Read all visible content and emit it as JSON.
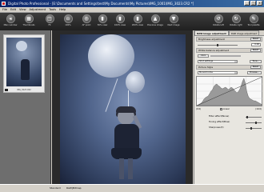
{
  "window": {
    "title": "Digital Photo Professional - [E:\\Documents and Settings\\test\\My Documents\\My Pictures\\IMG_1001\\IMG_3023.CR2 *]",
    "controls": [
      "_",
      "□",
      "x"
    ]
  },
  "menu": [
    "File",
    "Edit",
    "View",
    "Adjustment",
    "Tools",
    "Help"
  ],
  "toolbar": {
    "left": [
      {
        "label": "Main window",
        "icon": "main-window-icon"
      },
      {
        "label": "Thumbnails",
        "icon": "thumbnails-icon"
      },
      {
        "label": "Fit",
        "icon": "fit-icon"
      },
      {
        "label": "100%",
        "icon": "zoom-100-icon"
      },
      {
        "label": "AF point",
        "icon": "af-point-icon"
      },
      {
        "label": "50% view",
        "icon": "view-50-icon"
      },
      {
        "label": "100% view",
        "icon": "view-100-icon"
      },
      {
        "label": "200% view",
        "icon": "view-200-icon"
      },
      {
        "label": "Previous image",
        "icon": "previous-image-icon"
      },
      {
        "label": "Next image",
        "icon": "next-image-icon"
      }
    ],
    "right": [
      {
        "label": "Rotate left",
        "icon": "rotate-left-icon"
      },
      {
        "label": "Rotate right",
        "icon": "rotate-right-icon"
      },
      {
        "label": "Tool palette",
        "icon": "tool-palette-icon"
      }
    ]
  },
  "thumbnail": {
    "filename": "IMG_3023.CR2"
  },
  "palette": {
    "tabs": [
      "RAW image adjustment",
      "RGB image adjustment"
    ],
    "brightness": {
      "title": "Brightness adjustment",
      "reset": "Reset",
      "value": "0.00",
      "level": 0.5
    },
    "white_balance": {
      "title": "White balance adjustment",
      "reset": "Reset",
      "click": "Click",
      "shot_settings": "Shot settings",
      "tune": "Tune..."
    },
    "picture_style": {
      "title": "Picture Style",
      "reset": "Reset",
      "style": "Monochrome",
      "browse": "Browse...",
      "range_min": "(0.0)",
      "range_max": "(10.0)",
      "linear_label": "Linear",
      "filter_label": "Filter effect(None)",
      "toning_label": "Toning effect(Blue)",
      "sharpness_label": "Sharpness(3)"
    },
    "histogram": [
      0,
      1,
      2,
      3,
      5,
      8,
      10,
      11,
      12,
      15,
      18,
      20,
      24,
      26,
      27,
      25,
      24,
      22,
      21,
      22,
      23,
      22,
      20,
      21,
      23,
      22,
      20,
      18,
      16,
      17,
      20,
      24,
      30,
      34,
      28,
      18,
      12,
      9,
      8,
      7,
      6,
      6,
      5,
      4,
      3,
      2,
      1
    ]
  },
  "status": {
    "style": "Standard",
    "mode": "RAW|Bitmap"
  }
}
